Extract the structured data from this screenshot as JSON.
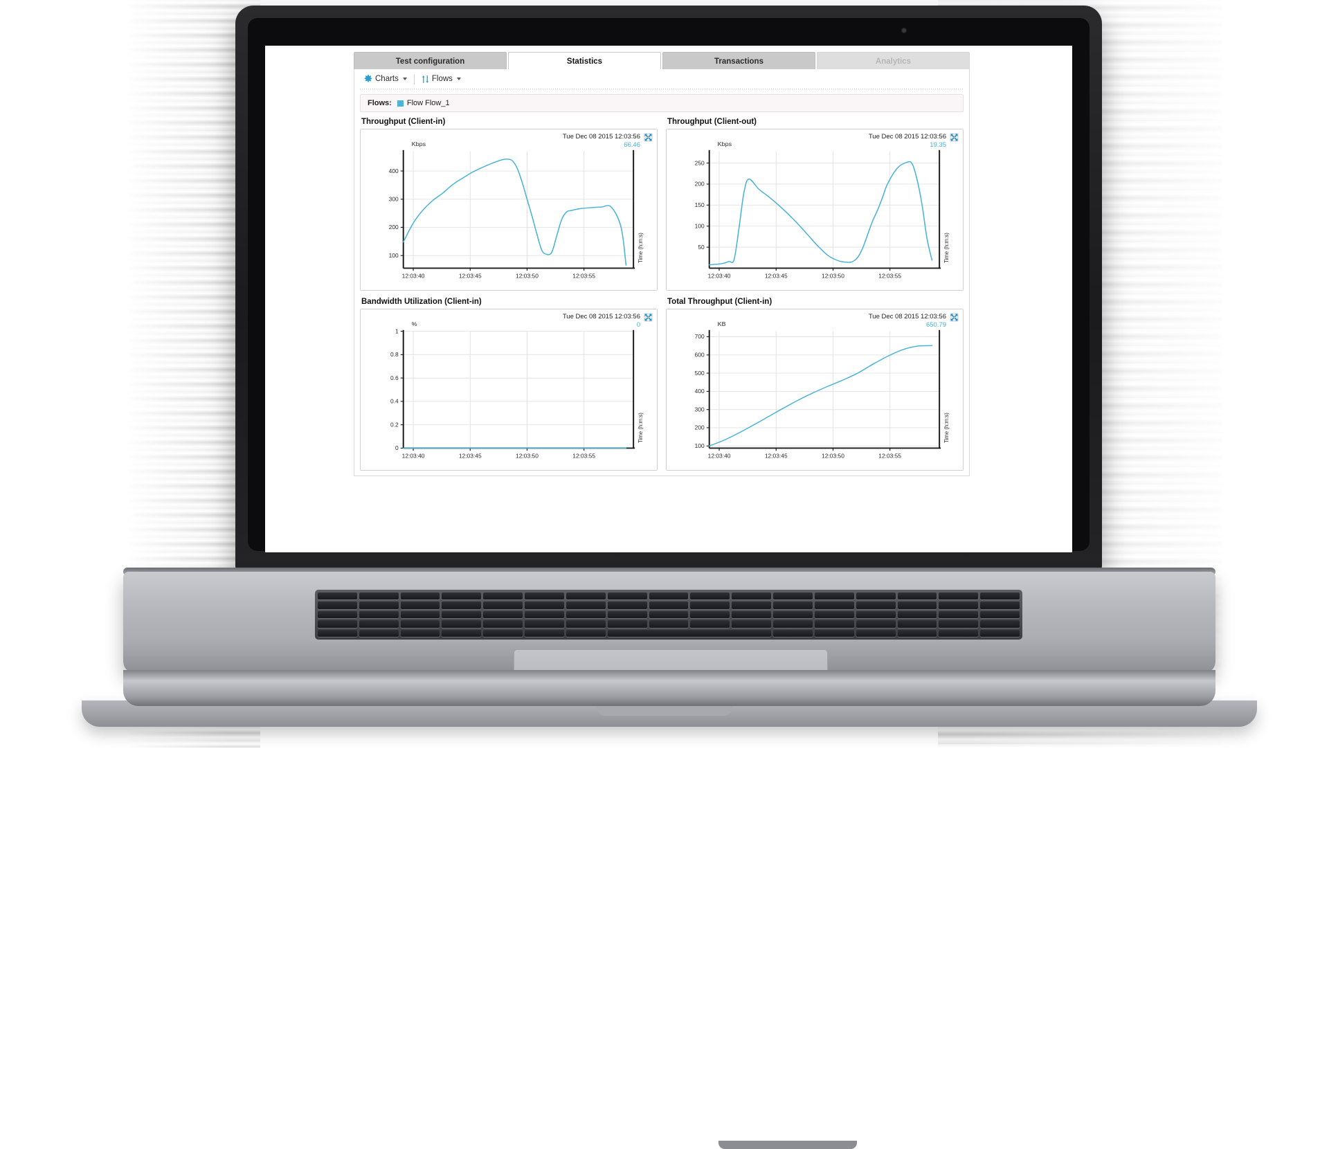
{
  "app": {
    "tabs": [
      {
        "label": "Test configuration",
        "state": "inactive"
      },
      {
        "label": "Statistics",
        "state": "active"
      },
      {
        "label": "Transactions",
        "state": "inactive"
      },
      {
        "label": "Analytics",
        "state": "disabled"
      }
    ],
    "toolbar": {
      "charts_label": "Charts",
      "flows_label": "Flows",
      "charts_icon": "gear-icon",
      "flows_icon": "flows-arrows-icon"
    },
    "flowbar": {
      "label": "Flows:",
      "items": [
        {
          "name": "Flow Flow_1",
          "color": "#4cb3d9"
        }
      ]
    },
    "accent_color": "#4cb3d9",
    "value_color": "#49b0d6"
  },
  "chart_data": [
    {
      "type": "line",
      "title": "Throughput (Client-in)",
      "timestamp": "Tue Dec 08 2015 12:03:56",
      "current_value": "66.46",
      "ylabel": "Kbps",
      "xlabel": "Time (h:m:s)",
      "yticks": [
        100,
        200,
        300,
        400
      ],
      "ylim": [
        55,
        470
      ],
      "xticks": [
        "12:03:40",
        "12:03:45",
        "12:03:50",
        "12:03:55"
      ],
      "grid": true,
      "series": [
        {
          "name": "Flow Flow_1",
          "color": "#4cb3d9",
          "x": [
            0,
            2,
            4,
            6,
            8,
            10,
            12,
            14,
            16,
            18,
            20,
            21,
            22,
            23,
            24,
            25,
            26,
            27,
            28,
            29,
            30,
            31,
            32,
            33,
            34,
            35,
            36,
            38,
            40,
            42,
            44,
            45
          ],
          "values": [
            148,
            215,
            262,
            296,
            322,
            352,
            375,
            396,
            413,
            428,
            440,
            442,
            437,
            410,
            360,
            300,
            240,
            175,
            118,
            104,
            112,
            170,
            228,
            255,
            260,
            264,
            267,
            270,
            272,
            272,
            200,
            66
          ]
        }
      ]
    },
    {
      "type": "line",
      "title": "Throughput (Client-out)",
      "timestamp": "Tue Dec 08 2015 12:03:56",
      "current_value": "19.35",
      "ylabel": "Kbps",
      "xlabel": "Time (h:m:s)",
      "yticks": [
        50,
        100,
        150,
        200,
        250
      ],
      "ylim": [
        0,
        278
      ],
      "xticks": [
        "12:03:40",
        "12:03:45",
        "12:03:50",
        "12:03:55"
      ],
      "grid": true,
      "series": [
        {
          "name": "Flow Flow_1",
          "color": "#4cb3d9",
          "x": [
            0,
            1,
            2,
            3,
            4,
            5,
            6,
            7,
            8,
            10,
            12,
            14,
            16,
            18,
            20,
            22,
            24,
            26,
            28,
            29,
            30,
            31,
            32,
            33,
            34,
            35,
            36,
            38,
            40,
            41,
            42,
            43,
            44,
            45
          ],
          "values": [
            8,
            9,
            10,
            12,
            16,
            20,
            95,
            180,
            212,
            188,
            170,
            150,
            128,
            104,
            78,
            52,
            30,
            18,
            14,
            16,
            26,
            48,
            80,
            112,
            138,
            168,
            200,
            238,
            252,
            248,
            210,
            150,
            70,
            19
          ]
        }
      ]
    },
    {
      "type": "line",
      "title": "Bandwidth Utilization (Client-in)",
      "timestamp": "Tue Dec 08 2015 12:03:56",
      "current_value": "0",
      "ylabel": "%",
      "xlabel": "Time (h:m:s)",
      "yticks": [
        0.0,
        0.2,
        0.4,
        0.6,
        0.8,
        1.0
      ],
      "ylim": [
        0,
        1
      ],
      "xticks": [
        "12:03:40",
        "12:03:45",
        "12:03:50",
        "12:03:55"
      ],
      "grid": true,
      "series": [
        {
          "name": "Flow Flow_1",
          "color": "#4cb3d9",
          "x": [
            0,
            10,
            20,
            30,
            40,
            45
          ],
          "values": [
            0,
            0,
            0,
            0,
            0,
            0
          ]
        }
      ]
    },
    {
      "type": "line",
      "title": "Total Throughput (Client-in)",
      "timestamp": "Tue Dec 08 2015 12:03:56",
      "current_value": "650.79",
      "ylabel": "KB",
      "xlabel": "Time (h:m:s)",
      "yticks": [
        100,
        200,
        300,
        400,
        500,
        600,
        700
      ],
      "ylim": [
        88,
        730
      ],
      "xticks": [
        "12:03:40",
        "12:03:45",
        "12:03:50",
        "12:03:55"
      ],
      "grid": true,
      "series": [
        {
          "name": "Flow Flow_1",
          "color": "#4cb3d9",
          "x": [
            0,
            3,
            6,
            9,
            12,
            15,
            18,
            21,
            24,
            27,
            30,
            33,
            36,
            39,
            42,
            45
          ],
          "values": [
            100,
            132,
            172,
            216,
            262,
            308,
            352,
            392,
            428,
            462,
            500,
            548,
            592,
            628,
            648,
            651
          ]
        }
      ]
    }
  ]
}
